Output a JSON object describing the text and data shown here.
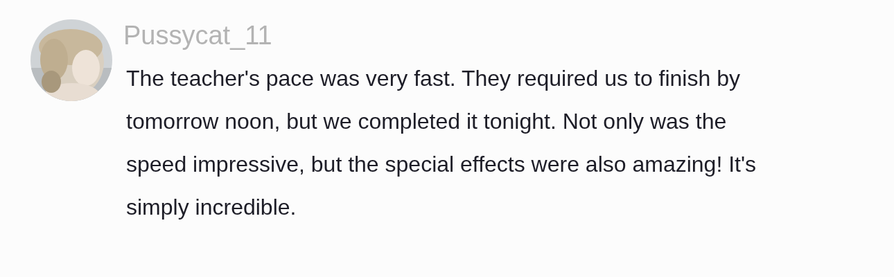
{
  "comment": {
    "username": "Pussycat_11",
    "text": "The teacher's pace was very fast. They required us to finish by tomorrow noon, but we completed it tonight. Not only was the speed impressive, but the special effects were also amazing! It's simply incredible."
  }
}
